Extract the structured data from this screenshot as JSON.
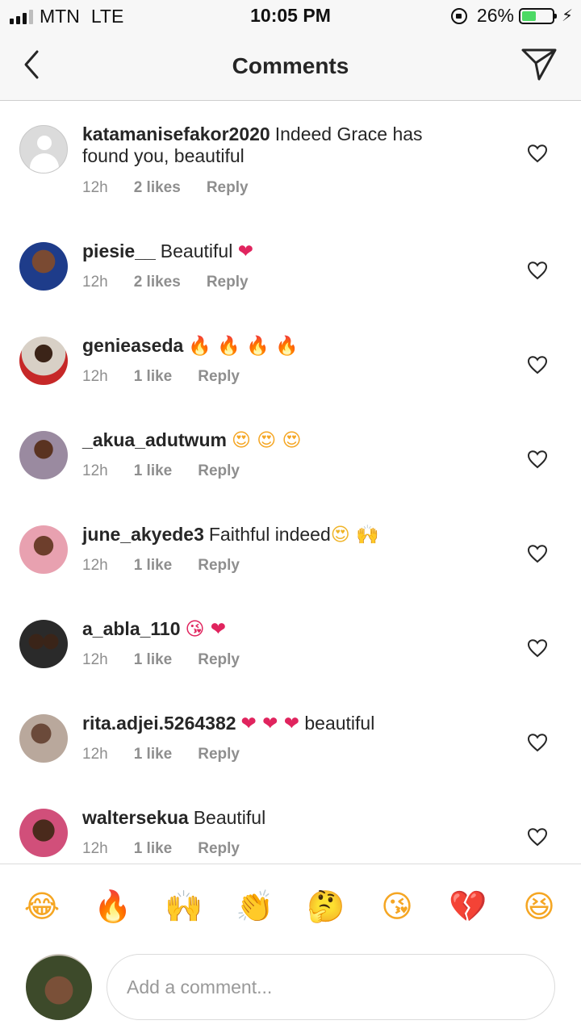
{
  "status_bar": {
    "carrier": "MTN",
    "network": "LTE",
    "time": "10:05 PM",
    "battery_percent": "26%",
    "battery_level": 0.26,
    "battery_color": "#4cd964"
  },
  "header": {
    "title": "Comments",
    "back_icon": "chevron-left-icon",
    "send_icon": "paper-plane-icon"
  },
  "comments": [
    {
      "username": "katamanisefakor2020",
      "text": "Indeed Grace has found you, beautiful",
      "time": "12h",
      "likes": "2 likes",
      "reply": "Reply"
    },
    {
      "username": "piesie__",
      "text": "Beautiful",
      "emoji": "❤",
      "time": "12h",
      "likes": "2 likes",
      "reply": "Reply"
    },
    {
      "username": "genieaseda",
      "text": "",
      "emoji": "🔥 🔥 🔥 🔥",
      "time": "12h",
      "likes": "1 like",
      "reply": "Reply"
    },
    {
      "username": "_akua_adutwum",
      "text": "",
      "emoji": "😍 😍 😍",
      "time": "12h",
      "likes": "1 like",
      "reply": "Reply"
    },
    {
      "username": "june_akyede3",
      "text": "Faithful indeed",
      "emoji": "😍 🙌",
      "time": "12h",
      "likes": "1 like",
      "reply": "Reply"
    },
    {
      "username": "a_abla_110",
      "text": "",
      "emoji": "😘 ❤",
      "time": "12h",
      "likes": "1 like",
      "reply": "Reply"
    },
    {
      "username": "rita.adjei.5264382",
      "text": "",
      "emoji": "❤ ❤ ❤",
      "text_after": "beautiful",
      "time": "12h",
      "likes": "1 like",
      "reply": "Reply"
    },
    {
      "username": "waltersekua",
      "text": "Beautiful",
      "time": "12h",
      "likes": "1 like",
      "reply": "Reply"
    }
  ],
  "emoji_bar": [
    "😂",
    "🔥",
    "🙌",
    "👏",
    "🤔",
    "😘",
    "💔",
    "😆"
  ],
  "compose": {
    "placeholder": "Add a comment..."
  }
}
